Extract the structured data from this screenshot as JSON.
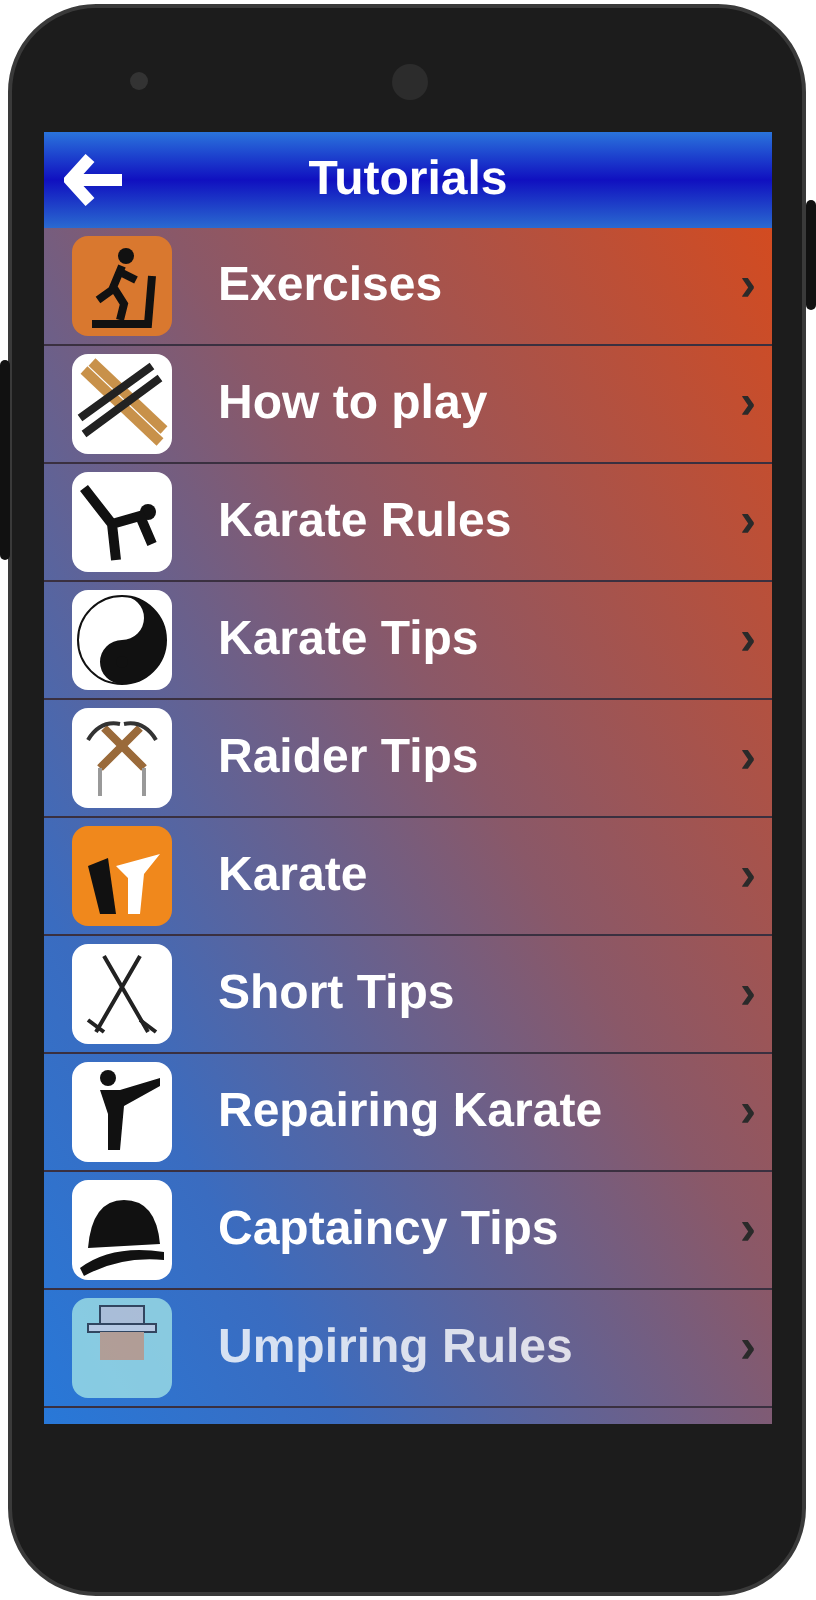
{
  "header": {
    "title": "Tutorials"
  },
  "items": [
    {
      "label": "Exercises",
      "chevron": "›"
    },
    {
      "label": "How to play",
      "chevron": "›"
    },
    {
      "label": "Karate Rules",
      "chevron": "›"
    },
    {
      "label": "Karate Tips",
      "chevron": "›"
    },
    {
      "label": "Raider Tips",
      "chevron": "›"
    },
    {
      "label": "Karate",
      "chevron": "›"
    },
    {
      "label": "Short Tips",
      "chevron": "›"
    },
    {
      "label": "Repairing Karate",
      "chevron": "›"
    },
    {
      "label": "Captaincy Tips",
      "chevron": "›"
    },
    {
      "label": "Umpiring Rules",
      "chevron": "›"
    }
  ]
}
